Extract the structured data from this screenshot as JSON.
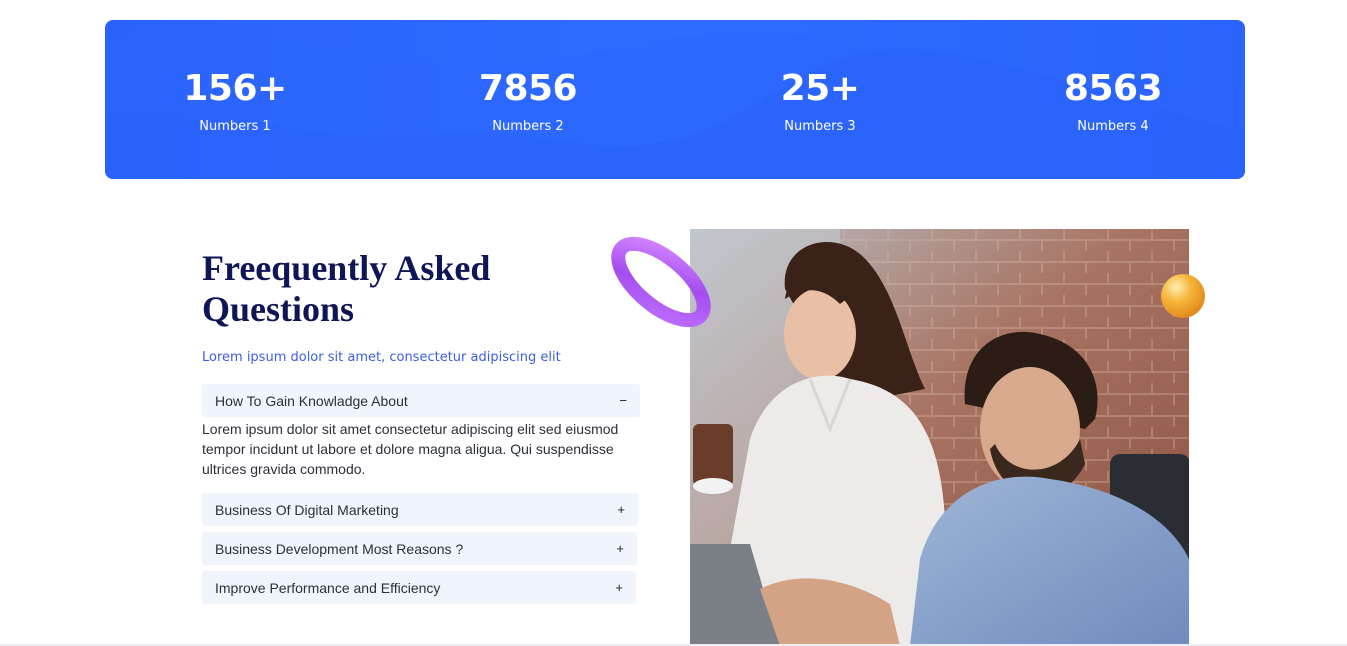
{
  "stats": [
    {
      "value": "156+",
      "label": "Numbers 1"
    },
    {
      "value": "7856",
      "label": "Numbers 2"
    },
    {
      "value": "25+",
      "label": "Numbers 3"
    },
    {
      "value": "8563",
      "label": "Numbers 4"
    }
  ],
  "faq": {
    "title": "Freequently Asked Questions",
    "subtitle": "Lorem ipsum dolor sit amet, consectetur adipiscing elit",
    "items": [
      {
        "question": "How To Gain Knowladge About",
        "sign": "−",
        "answer": "Lorem ipsum dolor sit amet consectetur adipiscing elit sed eiusmod tempor incidunt ut labore et dolore magna aligua. Qui suspendisse ultrices gravida commodo."
      },
      {
        "question": "Business Of Digital Marketing",
        "sign": "+"
      },
      {
        "question": "Business Development Most Reasons ?",
        "sign": "+"
      },
      {
        "question": "Improve Performance and Efficiency",
        "sign": "+"
      }
    ]
  },
  "colors": {
    "accent": "#2f6bff",
    "heading": "#0f1656",
    "subtitle": "#3c5fe0",
    "accordion_bg": "#f0f4fd"
  }
}
